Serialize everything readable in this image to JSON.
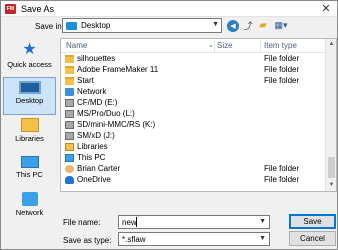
{
  "dialog": {
    "title": "Save As",
    "app_icon_text": "FM"
  },
  "toolbar": {
    "save_in_label": "Save in:",
    "save_in_value": "Desktop"
  },
  "places": [
    {
      "label": "Quick access"
    },
    {
      "label": "Desktop",
      "selected": true
    },
    {
      "label": "Libraries"
    },
    {
      "label": "This PC"
    },
    {
      "label": "Network"
    }
  ],
  "columns": {
    "name": "Name",
    "size": "Size",
    "type": "Item type"
  },
  "rows": [
    {
      "name": "silhouettes",
      "size": "",
      "type": "File folder",
      "icon": "folder-icon"
    },
    {
      "name": "Adobe FrameMaker 11",
      "size": "",
      "type": "File folder",
      "icon": "folder-icon"
    },
    {
      "name": "Start",
      "size": "",
      "type": "File folder",
      "icon": "folder-icon"
    },
    {
      "name": "Network",
      "size": "",
      "type": "",
      "icon": "network-icon"
    },
    {
      "name": "CF/MD (E:)",
      "size": "",
      "type": "",
      "icon": "drive-icon"
    },
    {
      "name": "MS/Pro/Duo (L:)",
      "size": "",
      "type": "",
      "icon": "drive-icon"
    },
    {
      "name": "SD/mini-MMC/RS (K:)",
      "size": "",
      "type": "",
      "icon": "drive-icon"
    },
    {
      "name": "SM/xD (J:)",
      "size": "",
      "type": "",
      "icon": "drive-icon"
    },
    {
      "name": "Libraries",
      "size": "",
      "type": "",
      "icon": "library-icon"
    },
    {
      "name": "This PC",
      "size": "",
      "type": "",
      "icon": "computer-icon"
    },
    {
      "name": "Brian Carter",
      "size": "",
      "type": "File folder",
      "icon": "user-icon"
    },
    {
      "name": "OneDrive",
      "size": "",
      "type": "File folder",
      "icon": "cloud-icon"
    }
  ],
  "filename": {
    "label": "File name:",
    "value": "new"
  },
  "filetype": {
    "label": "Save as type:",
    "value": "*.sflaw"
  },
  "buttons": {
    "save": "Save",
    "cancel": "Cancel"
  }
}
